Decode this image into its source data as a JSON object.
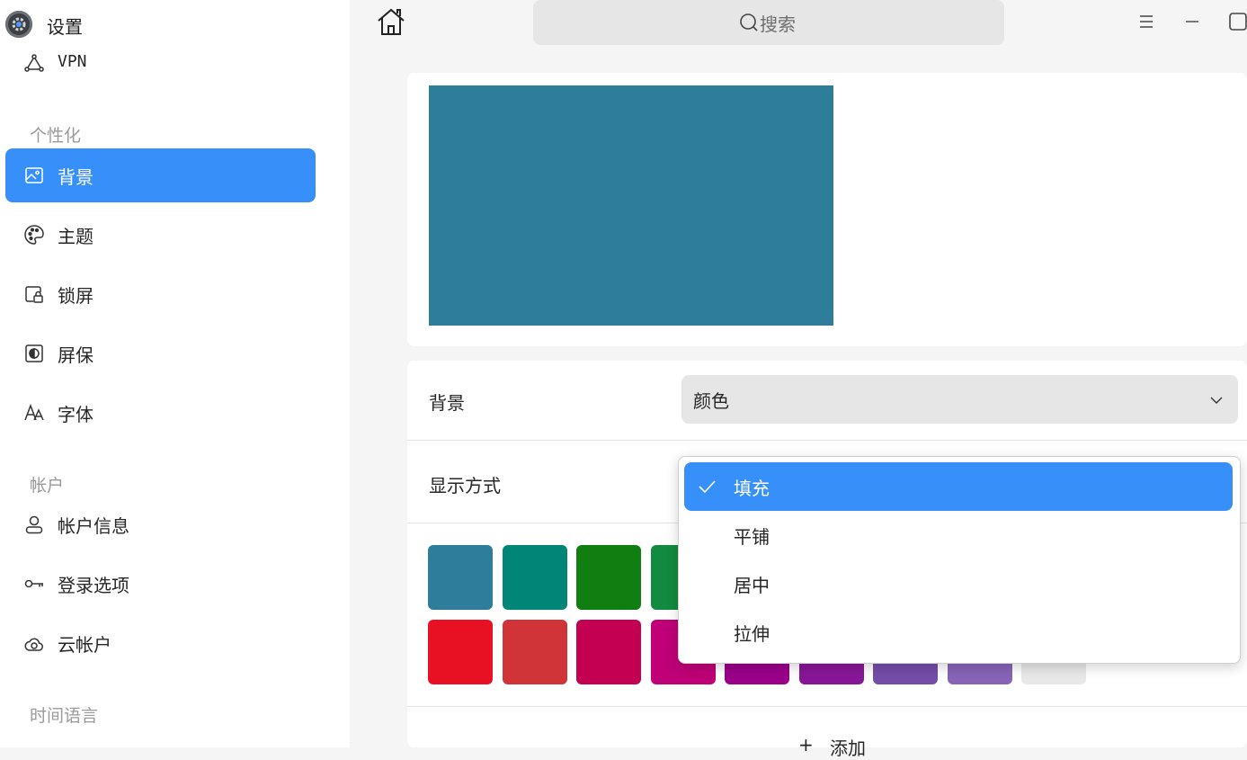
{
  "app": {
    "title": "设置"
  },
  "sidebar": {
    "vpn_label": "VPN",
    "groups": [
      {
        "title": "个性化"
      },
      {
        "title": "帐户"
      },
      {
        "title": "时间语言"
      }
    ],
    "items": [
      {
        "label": "背景",
        "icon": "image-icon",
        "active": true
      },
      {
        "label": "主题",
        "icon": "palette-icon"
      },
      {
        "label": "锁屏",
        "icon": "lock-screen-icon"
      },
      {
        "label": "屏保",
        "icon": "screensaver-icon"
      },
      {
        "label": "字体",
        "icon": "font-icon"
      },
      {
        "label": "帐户信息",
        "icon": "user-icon"
      },
      {
        "label": "登录选项",
        "icon": "key-icon"
      },
      {
        "label": "云帐户",
        "icon": "cloud-icon"
      }
    ]
  },
  "header": {
    "search_placeholder": "搜索"
  },
  "main": {
    "preview_color": "#2e7d9a",
    "background_row": {
      "label": "背景",
      "value": "颜色"
    },
    "display_row": {
      "label": "显示方式"
    },
    "swatches_row1": [
      "#2e7d9a",
      "#008577",
      "#117e11",
      "#128a3f"
    ],
    "swatches_row2": [
      "#e81123",
      "#d13438",
      "#c30052",
      "#bf0077",
      "#9a0089",
      "#881798",
      "#744da9",
      "#8764b8",
      "#e8e8e8"
    ],
    "add_label": "添加"
  },
  "dropdown": {
    "options": [
      {
        "label": "填充",
        "selected": true
      },
      {
        "label": "平铺"
      },
      {
        "label": "居中"
      },
      {
        "label": "拉伸"
      }
    ]
  },
  "colors": {
    "accent": "#3790fa"
  }
}
